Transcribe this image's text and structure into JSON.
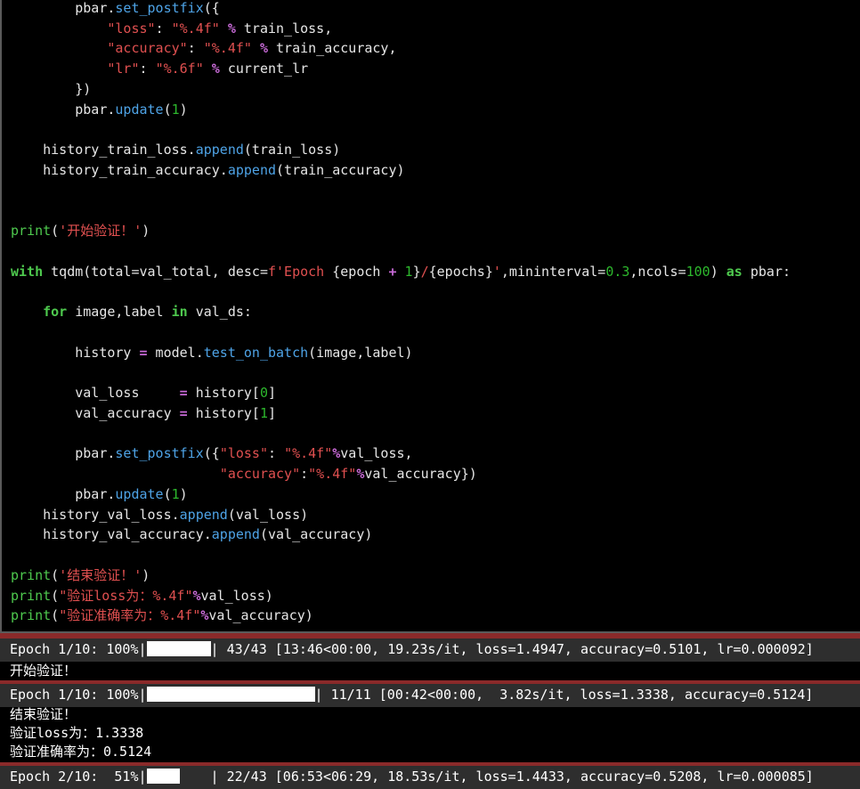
{
  "code_lines": [
    [
      {
        "t": "        pbar.",
        "c": "plain"
      },
      {
        "t": "set_postfix",
        "c": "func"
      },
      {
        "t": "({",
        "c": "plain"
      }
    ],
    [
      {
        "t": "            ",
        "c": "plain"
      },
      {
        "t": "\"loss\"",
        "c": "str"
      },
      {
        "t": ": ",
        "c": "plain"
      },
      {
        "t": "\"%.4f\"",
        "c": "str"
      },
      {
        "t": " ",
        "c": "plain"
      },
      {
        "t": "%",
        "c": "op"
      },
      {
        "t": " train_loss,",
        "c": "plain"
      }
    ],
    [
      {
        "t": "            ",
        "c": "plain"
      },
      {
        "t": "\"accuracy\"",
        "c": "str"
      },
      {
        "t": ": ",
        "c": "plain"
      },
      {
        "t": "\"%.4f\"",
        "c": "str"
      },
      {
        "t": " ",
        "c": "plain"
      },
      {
        "t": "%",
        "c": "op"
      },
      {
        "t": " train_accuracy,",
        "c": "plain"
      }
    ],
    [
      {
        "t": "            ",
        "c": "plain"
      },
      {
        "t": "\"lr\"",
        "c": "str"
      },
      {
        "t": ": ",
        "c": "plain"
      },
      {
        "t": "\"%.6f\"",
        "c": "str"
      },
      {
        "t": " ",
        "c": "plain"
      },
      {
        "t": "%",
        "c": "op"
      },
      {
        "t": " current_lr",
        "c": "plain"
      }
    ],
    [
      {
        "t": "        })",
        "c": "plain"
      }
    ],
    [
      {
        "t": "        pbar.",
        "c": "plain"
      },
      {
        "t": "update",
        "c": "func"
      },
      {
        "t": "(",
        "c": "plain"
      },
      {
        "t": "1",
        "c": "num"
      },
      {
        "t": ")",
        "c": "plain"
      }
    ],
    [],
    [
      {
        "t": "    history_train_loss.",
        "c": "plain"
      },
      {
        "t": "append",
        "c": "func"
      },
      {
        "t": "(train_loss)",
        "c": "plain"
      }
    ],
    [
      {
        "t": "    history_train_accuracy.",
        "c": "plain"
      },
      {
        "t": "append",
        "c": "func"
      },
      {
        "t": "(train_accuracy)",
        "c": "plain"
      }
    ],
    [],
    [],
    [
      {
        "t": "print",
        "c": "builtin"
      },
      {
        "t": "(",
        "c": "plain"
      },
      {
        "t": "'开始验证！'",
        "c": "str"
      },
      {
        "t": ")",
        "c": "plain"
      }
    ],
    [],
    [
      {
        "t": "with",
        "c": "kw"
      },
      {
        "t": " tqdm(total=val_total, desc=",
        "c": "plain"
      },
      {
        "t": "f'Epoch ",
        "c": "str"
      },
      {
        "t": "{epoch ",
        "c": "plain"
      },
      {
        "t": "+",
        "c": "op"
      },
      {
        "t": " ",
        "c": "plain"
      },
      {
        "t": "1",
        "c": "num"
      },
      {
        "t": "}",
        "c": "plain"
      },
      {
        "t": "/",
        "c": "str"
      },
      {
        "t": "{epochs}",
        "c": "plain"
      },
      {
        "t": "'",
        "c": "str"
      },
      {
        "t": ",mininterval=",
        "c": "plain"
      },
      {
        "t": "0.3",
        "c": "num"
      },
      {
        "t": ",ncols=",
        "c": "plain"
      },
      {
        "t": "100",
        "c": "num"
      },
      {
        "t": ") ",
        "c": "plain"
      },
      {
        "t": "as",
        "c": "kw"
      },
      {
        "t": " pbar:",
        "c": "plain"
      }
    ],
    [],
    [
      {
        "t": "    ",
        "c": "plain"
      },
      {
        "t": "for",
        "c": "kw"
      },
      {
        "t": " image,label ",
        "c": "plain"
      },
      {
        "t": "in",
        "c": "kw"
      },
      {
        "t": " val_ds:",
        "c": "plain"
      }
    ],
    [],
    [
      {
        "t": "        history ",
        "c": "plain"
      },
      {
        "t": "=",
        "c": "op"
      },
      {
        "t": " model.",
        "c": "plain"
      },
      {
        "t": "test_on_batch",
        "c": "func"
      },
      {
        "t": "(image,label)",
        "c": "plain"
      }
    ],
    [],
    [
      {
        "t": "        val_loss     ",
        "c": "plain"
      },
      {
        "t": "=",
        "c": "op"
      },
      {
        "t": " history[",
        "c": "plain"
      },
      {
        "t": "0",
        "c": "num"
      },
      {
        "t": "]",
        "c": "plain"
      }
    ],
    [
      {
        "t": "        val_accuracy ",
        "c": "plain"
      },
      {
        "t": "=",
        "c": "op"
      },
      {
        "t": " history[",
        "c": "plain"
      },
      {
        "t": "1",
        "c": "num"
      },
      {
        "t": "]",
        "c": "plain"
      }
    ],
    [],
    [
      {
        "t": "        pbar.",
        "c": "plain"
      },
      {
        "t": "set_postfix",
        "c": "func"
      },
      {
        "t": "({",
        "c": "plain"
      },
      {
        "t": "\"loss\"",
        "c": "str"
      },
      {
        "t": ": ",
        "c": "plain"
      },
      {
        "t": "\"%.4f\"",
        "c": "str"
      },
      {
        "t": "%",
        "c": "op"
      },
      {
        "t": "val_loss,",
        "c": "plain"
      }
    ],
    [
      {
        "t": "                          ",
        "c": "plain"
      },
      {
        "t": "\"accuracy\"",
        "c": "str"
      },
      {
        "t": ":",
        "c": "plain"
      },
      {
        "t": "\"%.4f\"",
        "c": "str"
      },
      {
        "t": "%",
        "c": "op"
      },
      {
        "t": "val_accuracy})",
        "c": "plain"
      }
    ],
    [
      {
        "t": "        pbar.",
        "c": "plain"
      },
      {
        "t": "update",
        "c": "func"
      },
      {
        "t": "(",
        "c": "plain"
      },
      {
        "t": "1",
        "c": "num"
      },
      {
        "t": ")",
        "c": "plain"
      }
    ],
    [
      {
        "t": "    history_val_loss.",
        "c": "plain"
      },
      {
        "t": "append",
        "c": "func"
      },
      {
        "t": "(val_loss)",
        "c": "plain"
      }
    ],
    [
      {
        "t": "    history_val_accuracy.",
        "c": "plain"
      },
      {
        "t": "append",
        "c": "func"
      },
      {
        "t": "(val_accuracy)",
        "c": "plain"
      }
    ],
    [],
    [
      {
        "t": "print",
        "c": "builtin"
      },
      {
        "t": "(",
        "c": "plain"
      },
      {
        "t": "'结束验证！'",
        "c": "str"
      },
      {
        "t": ")",
        "c": "plain"
      }
    ],
    [
      {
        "t": "print",
        "c": "builtin"
      },
      {
        "t": "(",
        "c": "plain"
      },
      {
        "t": "\"验证loss为：%.4f\"",
        "c": "str"
      },
      {
        "t": "%",
        "c": "op"
      },
      {
        "t": "val_loss)",
        "c": "plain"
      }
    ],
    [
      {
        "t": "print",
        "c": "builtin"
      },
      {
        "t": "(",
        "c": "plain"
      },
      {
        "t": "\"验证准确率为：%.4f\"",
        "c": "str"
      },
      {
        "t": "%",
        "c": "op"
      },
      {
        "t": "val_accuracy)",
        "c": "plain"
      }
    ]
  ],
  "output": {
    "bar1": {
      "prefix": "Epoch 1/10: 100%|",
      "progress": 1.0,
      "suffix": "| 43/43 [13:46<00:00, 19.23s/it, loss=1.4947, accuracy=0.5101, lr=0.000092]"
    },
    "line1": "开始验证！",
    "bar2": {
      "prefix": "Epoch 1/10: 100%|",
      "progress": 1.0,
      "suffix": "| 11/11 [00:42<00:00,  3.82s/it, loss=1.3338, accuracy=0.5124]"
    },
    "line2": "结束验证！",
    "line3": "验证loss为：1.3338",
    "line4": "验证准确率为：0.5124",
    "bar3": {
      "prefix": "Epoch 2/10:  51%|",
      "progress": 0.51,
      "suffix": "| 22/43 [06:53<06:29, 18.53s/it, loss=1.4433, accuracy=0.5208, lr=0.000085]"
    }
  },
  "colors": {
    "background": "#000000",
    "string": "#e05050",
    "function": "#4ea3e6",
    "keyword": "#4ec94e",
    "number": "#2db82d",
    "operator": "#c76ad6",
    "error_separator": "#8a2a2a"
  }
}
